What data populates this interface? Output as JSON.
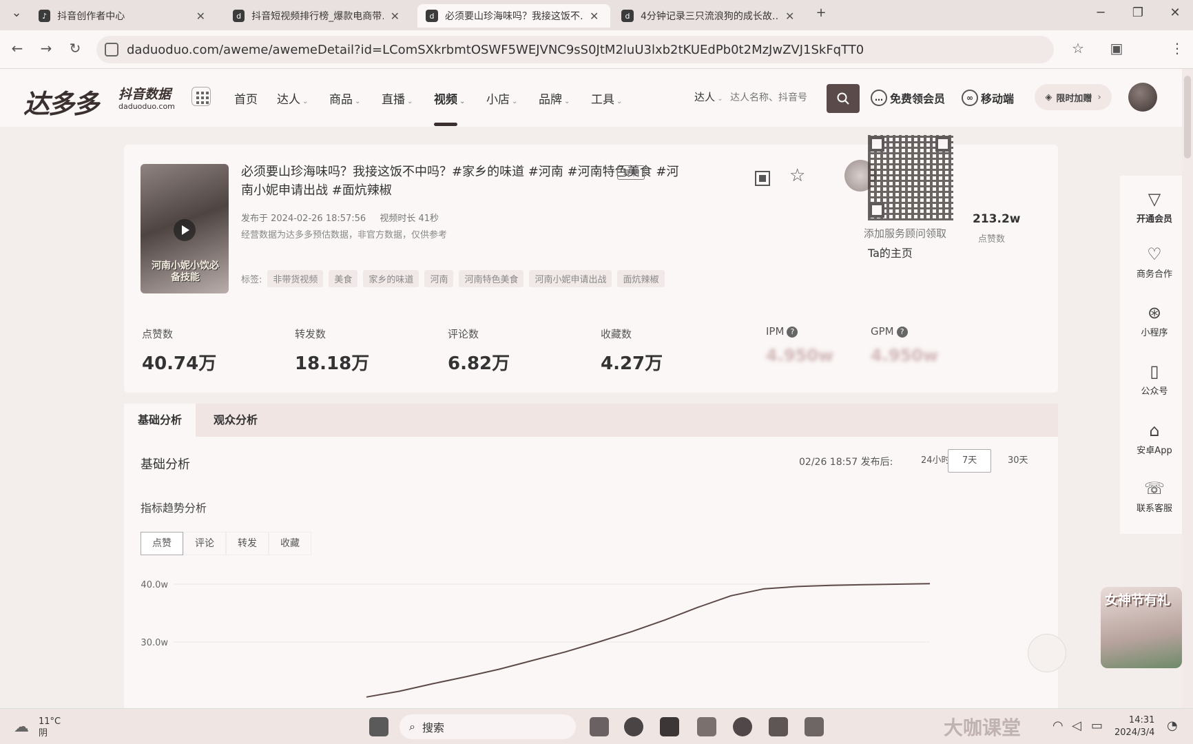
{
  "browser": {
    "tabs": [
      {
        "label": "抖音创作者中心",
        "active": false
      },
      {
        "label": "抖音短视频排行榜_爆款电商带…",
        "active": false
      },
      {
        "label": "必须要山珍海味吗？我接这饭不…",
        "active": true
      },
      {
        "label": "4分钟记录三只流浪狗的成长故…",
        "active": false
      }
    ],
    "new_tab": "+",
    "url": "daduoduo.com/aweme/awemeDetail?id=LComSXkrbmtOSWF5WEJVNC9sS0JtM2luU3lxb2tKUEdPb0t2MzJwZVJ1SkFqTT0"
  },
  "site": {
    "logo": "达多多",
    "logo_sub": "抖音数据",
    "logo_domain": "daduoduo.com",
    "menu": [
      {
        "label": "首页",
        "dropdown": false
      },
      {
        "label": "达人",
        "dropdown": true
      },
      {
        "label": "商品",
        "dropdown": true
      },
      {
        "label": "直播",
        "dropdown": true
      },
      {
        "label": "视频",
        "dropdown": true
      },
      {
        "label": "小店",
        "dropdown": true
      },
      {
        "label": "品牌",
        "dropdown": true
      },
      {
        "label": "工具",
        "dropdown": true
      }
    ],
    "active_menu": "视频",
    "search_scope": "达人",
    "search_placeholder": "达人名称、抖音号",
    "free_member": "免费领会员",
    "mobile": "移动端",
    "limited_offer": "限时加赠"
  },
  "video": {
    "thumb_caption": "河南小妮小饮必备技能",
    "title": "必须要山珍海味吗？我接这饭不中吗？#家乡的味道 #河南 #河南特色美食 #河南小妮申请出战 #面炕辣椒",
    "copy": "复制",
    "published": "发布于 2024-02-26 18:57:56",
    "duration": "视频时长 41秒",
    "disclaimer": "经营数据为达多多预估数据，非官方数据，仅供参考",
    "tags_label": "标签:",
    "tags": [
      "非带货视频",
      "美食",
      "家乡的味道",
      "河南",
      "河南特色美食",
      "河南小妮申请出战",
      "面炕辣椒"
    ],
    "qr_caption": "添加服务顾问领取",
    "author_likes": "213.2w",
    "author_likes_label": "点赞数",
    "homepage": "Ta的主页"
  },
  "stats": [
    {
      "label": "点赞数",
      "value": "40.74万"
    },
    {
      "label": "转发数",
      "value": "18.18万"
    },
    {
      "label": "评论数",
      "value": "6.82万"
    },
    {
      "label": "收藏数",
      "value": "4.27万"
    },
    {
      "label": "IPM",
      "value": "4.950w"
    },
    {
      "label": "GPM",
      "value": "4.950w"
    }
  ],
  "analysis": {
    "tabs": [
      "基础分析",
      "观众分析"
    ],
    "active_tab": "基础分析",
    "section_title": "基础分析",
    "time_info": "02/26 18:57 发布后:",
    "ranges": [
      "24小时",
      "7天",
      "30天"
    ],
    "active_range": "7天",
    "trend_title": "指标趋势分析",
    "metrics": [
      "点赞",
      "评论",
      "转发",
      "收藏"
    ],
    "active_metric": "点赞"
  },
  "chart_data": {
    "type": "line",
    "title": "",
    "xlabel": "",
    "ylabel": "",
    "y_ticks": [
      "40.0w",
      "30.0w"
    ],
    "ylim": [
      20,
      41
    ],
    "series": [
      {
        "values": [
          [
            0,
            20.5
          ],
          [
            5,
            21.5
          ],
          [
            10,
            22.8
          ],
          [
            15,
            24.0
          ],
          [
            20,
            25.3
          ],
          [
            25,
            26.8
          ],
          [
            30,
            28.3
          ],
          [
            35,
            30.0
          ],
          [
            40,
            31.8
          ],
          [
            45,
            33.8
          ],
          [
            50,
            36.0
          ],
          [
            55,
            38.0
          ],
          [
            60,
            39.2
          ],
          [
            65,
            39.6
          ],
          [
            70,
            39.8
          ],
          [
            75,
            39.9
          ],
          [
            80,
            40.0
          ],
          [
            85,
            40.1
          ]
        ]
      }
    ],
    "grid": true,
    "color": "#5c4a48"
  },
  "sidebar": {
    "items": [
      "开通会员",
      "商务合作",
      "小程序",
      "公众号",
      "安卓App",
      "联系客服"
    ],
    "promo": "女神节有礼"
  },
  "taskbar": {
    "temperature": "11°C",
    "weather": "阴",
    "search": "搜索",
    "time": "14:31",
    "date": "2024/3/4",
    "watermark": "大咖课堂"
  }
}
